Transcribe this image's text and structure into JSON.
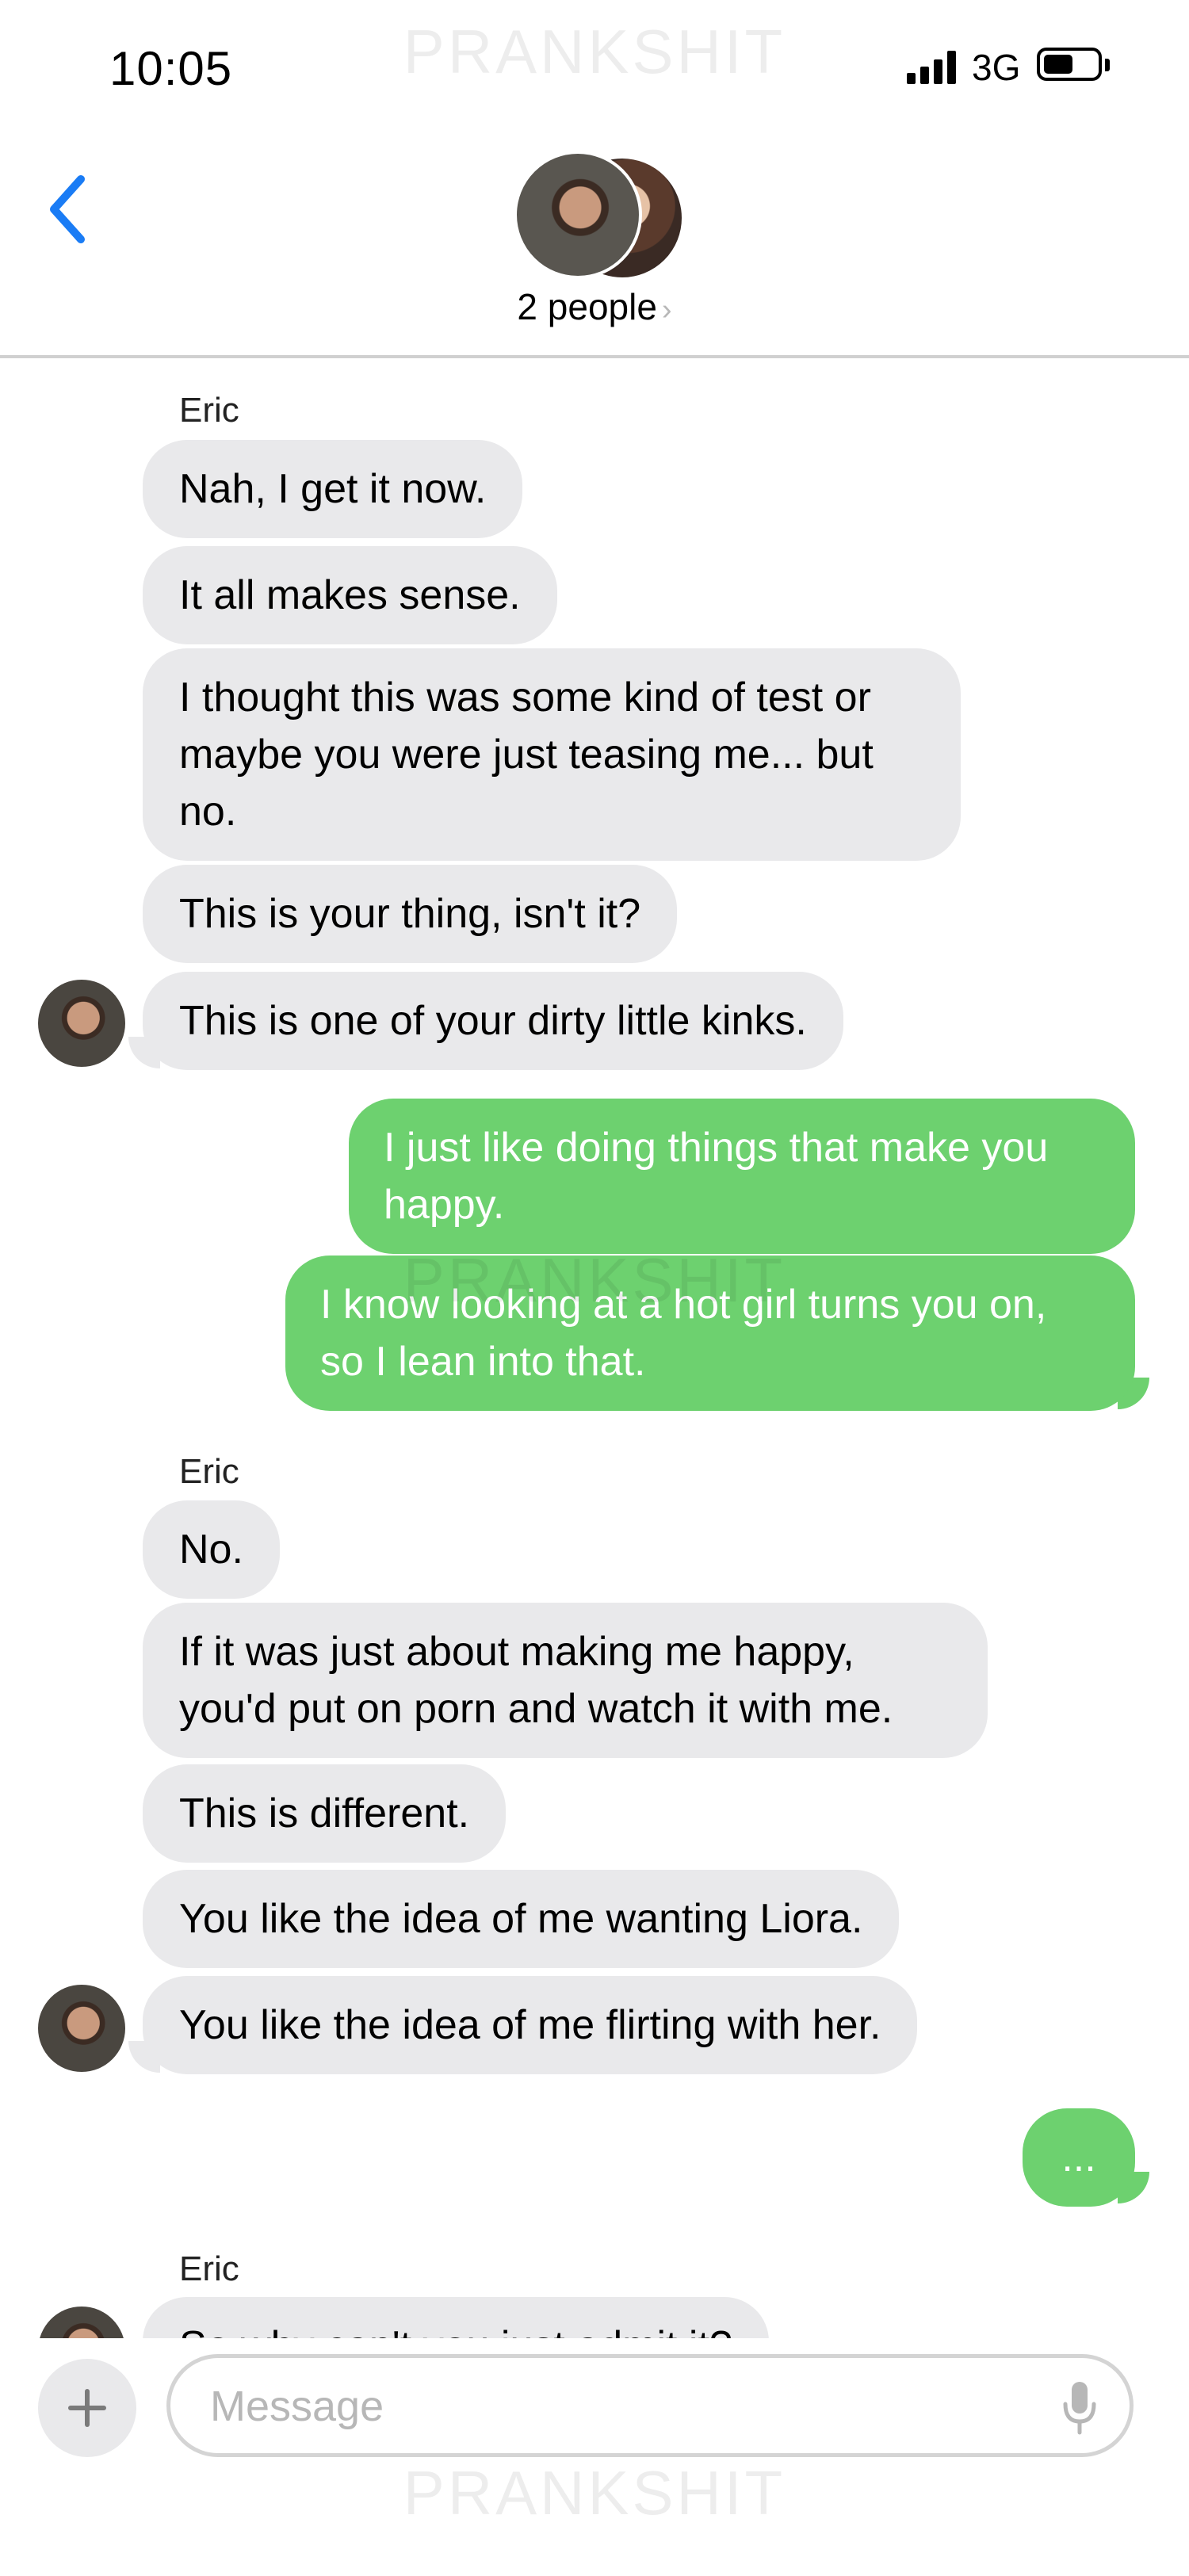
{
  "status_bar": {
    "time": "10:05",
    "network": "3G"
  },
  "watermark": "PRANKSHIT",
  "header": {
    "group_title": "2 people",
    "chevron": "›"
  },
  "messages": [
    {
      "sender": "Eric"
    },
    {
      "text": "Nah, I get it now."
    },
    {
      "text": "It all makes sense."
    },
    {
      "text": "I thought this was some kind of test or maybe you were just teasing me... but no."
    },
    {
      "text": "This is your thing, isn't it?"
    },
    {
      "text": "This is one of your dirty little kinks."
    },
    {
      "text": "I just like doing things that make you happy."
    },
    {
      "text": "I know looking at a hot girl turns you on, so I lean into that."
    },
    {
      "sender": "Eric"
    },
    {
      "text": "No."
    },
    {
      "text": "If it was just about making me happy, you'd put on porn and watch it with me."
    },
    {
      "text": "This is different."
    },
    {
      "text": "You like the idea of me wanting Liora."
    },
    {
      "text": "You like the idea of me flirting with her."
    },
    {
      "text": "..."
    },
    {
      "sender": "Eric"
    },
    {
      "text": "So why can't you just admit it?"
    }
  ],
  "composer": {
    "placeholder": "Message"
  },
  "colors": {
    "accent_blue": "#1a7cf5",
    "outgoing_green": "#6dd16f",
    "incoming_gray": "#e9e9eb"
  },
  "icons": [
    "back-chevron-icon",
    "plus-icon",
    "microphone-icon",
    "signal-icon",
    "battery-icon"
  ]
}
